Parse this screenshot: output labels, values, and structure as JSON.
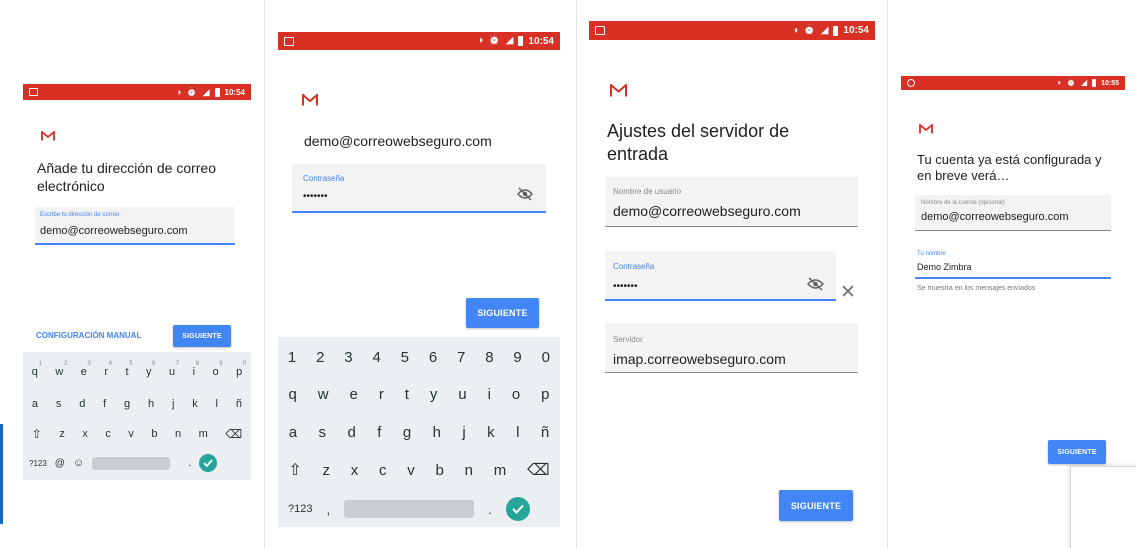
{
  "colors": {
    "statusbar": "#d93025",
    "accent": "#4285f4",
    "enter_key": "#26a69a",
    "gmail_red": "#d93025"
  },
  "icons": {
    "gmail": "gmail-m-icon",
    "eye": "eye-off-icon",
    "close": "close-icon",
    "shift": "shift-icon",
    "backspace": "backspace-icon",
    "check": "check-icon",
    "emoji": "emoji-icon"
  },
  "screen1": {
    "time": "10:54",
    "heading": "Añade tu dirección de correo electrónico",
    "email_label": "Escribe tu dirección de correo",
    "email_value": "demo@correowebseguro.com",
    "manual_button": "CONFIGURACIÓN MANUAL",
    "next_button": "SIGUIENTE",
    "keyboard": {
      "row1": [
        "q",
        "w",
        "e",
        "r",
        "t",
        "y",
        "u",
        "i",
        "o",
        "p"
      ],
      "row1_hints": [
        "1",
        "2",
        "3",
        "4",
        "5",
        "6",
        "7",
        "8",
        "9",
        "0"
      ],
      "row2": [
        "a",
        "s",
        "d",
        "f",
        "g",
        "h",
        "j",
        "k",
        "l",
        "ñ"
      ],
      "row3": [
        "z",
        "x",
        "c",
        "v",
        "b",
        "n",
        "m"
      ],
      "symbols": "?123",
      "at": "@",
      "period": "."
    }
  },
  "screen2": {
    "time": "10:54",
    "account": "demo@correowebseguro.com",
    "password_label": "Contraseña",
    "password_value": "•••••••",
    "next_button": "SIGUIENTE",
    "keyboard": {
      "numbers": [
        "1",
        "2",
        "3",
        "4",
        "5",
        "6",
        "7",
        "8",
        "9",
        "0"
      ],
      "row1": [
        "q",
        "w",
        "e",
        "r",
        "t",
        "y",
        "u",
        "i",
        "o",
        "p"
      ],
      "row2": [
        "a",
        "s",
        "d",
        "f",
        "g",
        "h",
        "j",
        "k",
        "l",
        "ñ"
      ],
      "row3": [
        "z",
        "x",
        "c",
        "v",
        "b",
        "n",
        "m"
      ],
      "symbols": "?123",
      "comma": ",",
      "period": "."
    }
  },
  "screen3": {
    "time": "10:54",
    "heading": "Ajustes del servidor de entrada",
    "username_label": "Nombre de usuario",
    "username_value": "demo@correowebseguro.com",
    "password_label": "Contraseña",
    "password_value": "•••••••",
    "server_label": "Servidor",
    "server_value": "imap.correowebseguro.com",
    "next_button": "SIGUIENTE"
  },
  "screen4": {
    "time": "10:55",
    "heading": "Tu cuenta ya está configurada y en breve verá…",
    "account_name_label": "Nombre de la cuenta (opcional)",
    "account_name_value": "demo@correowebseguro.com",
    "your_name_label": "Tu nombre",
    "your_name_value": "Demo Zimbra",
    "helper": "Se muestra en los mensajes enviados",
    "next_button": "SIGUIENTE"
  }
}
